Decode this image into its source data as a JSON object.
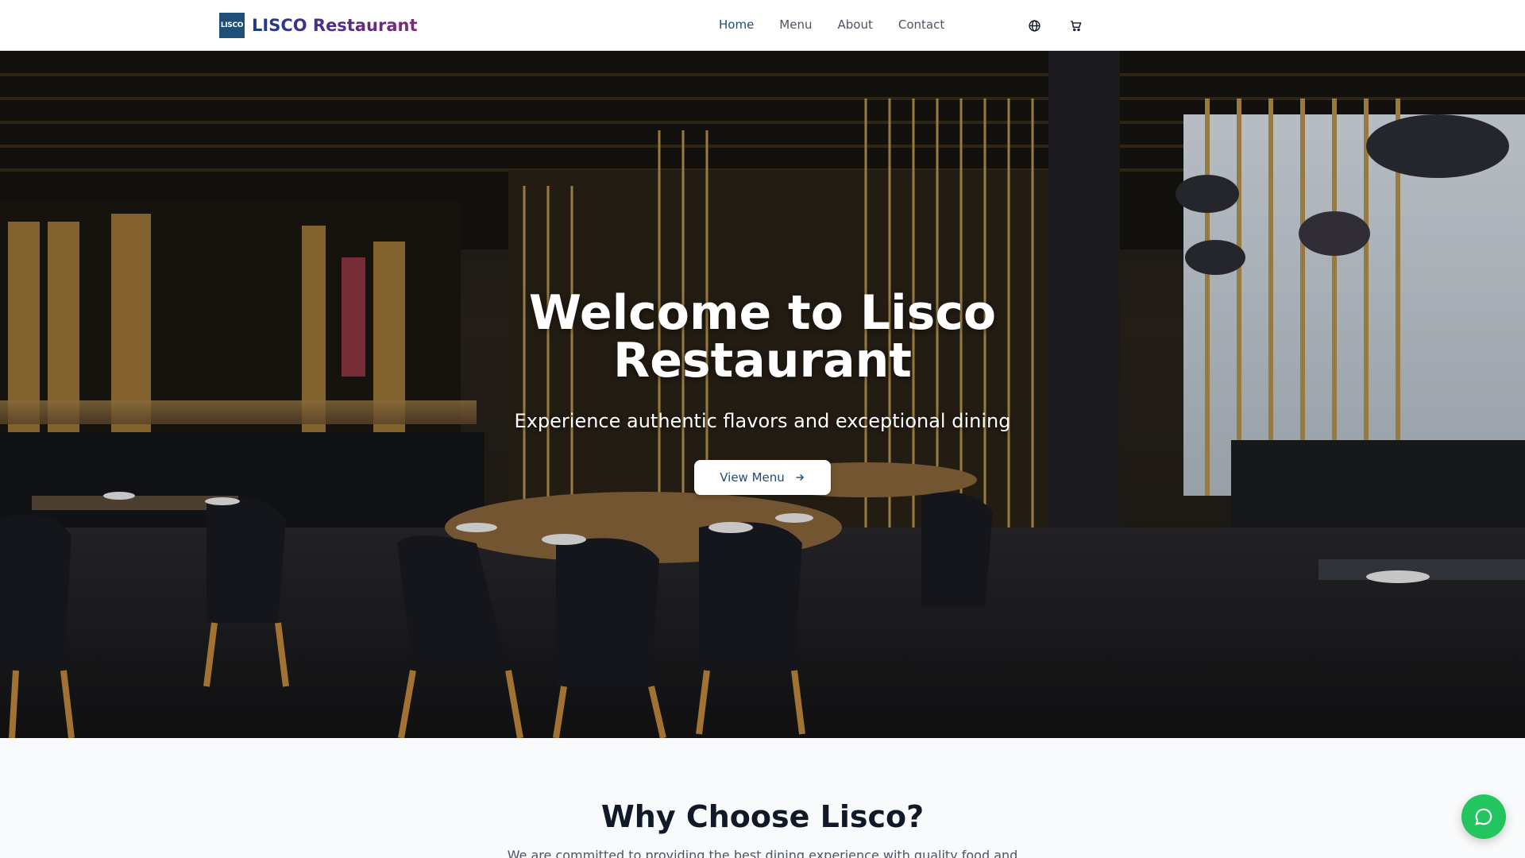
{
  "brand": {
    "logo_text": "LISCO",
    "name": "LISCO Restaurant",
    "logo_color": "#1f4e79"
  },
  "nav": {
    "links": [
      {
        "label": "Home",
        "active": true
      },
      {
        "label": "Menu",
        "active": false
      },
      {
        "label": "About",
        "active": false
      },
      {
        "label": "Contact",
        "active": false
      }
    ],
    "actions": [
      {
        "icon": "globe-icon"
      },
      {
        "icon": "cart-icon"
      }
    ]
  },
  "hero": {
    "title": "Welcome to Lisco Restaurant",
    "subtitle": "Experience authentic flavors and exceptional dining",
    "cta_label": "View Menu",
    "cta_icon": "arrow-right-icon",
    "image": "restaurant-interior-photo"
  },
  "why": {
    "title": "Why Choose Lisco?",
    "text": "We are committed to providing the best dining experience with quality food and"
  },
  "chat": {
    "icon": "chat-bubble-icon",
    "color": "#22c55e"
  },
  "colors": {
    "accent": "#1f4e79",
    "background": "#f9fafb"
  }
}
